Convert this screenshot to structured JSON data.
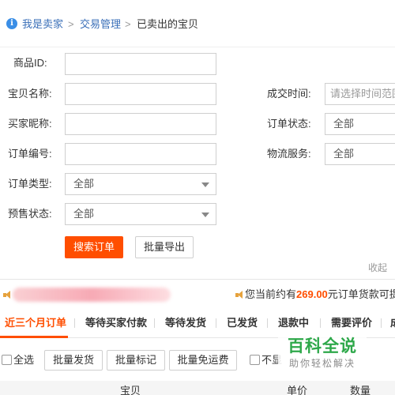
{
  "breadcrumb": {
    "items": [
      "我是卖家",
      "交易管理",
      "已卖出的宝贝"
    ],
    "separator": ">"
  },
  "form": {
    "item_id_label": "商品ID:",
    "item_name_label": "宝贝名称:",
    "buyer_nick_label": "买家昵称:",
    "order_no_label": "订单编号:",
    "order_type_label": "订单类型:",
    "order_type_value": "全部",
    "presale_label": "预售状态:",
    "presale_value": "全部",
    "deal_time_label": "成交时间:",
    "deal_time_placeholder": "请选择时间范围",
    "order_status_label": "订单状态:",
    "order_status_value": "全部",
    "logistics_label": "物流服务:",
    "logistics_value": "全部",
    "search_button": "搜索订单",
    "export_button": "批量导出",
    "collapse": "收起"
  },
  "notice": {
    "prefix": "您当前约有",
    "amount": "269.00",
    "suffix": "元订单货款可提"
  },
  "tabs": [
    "近三个月订单",
    "等待买家付款",
    "等待发货",
    "已发货",
    "退款中",
    "需要评价",
    "成"
  ],
  "bulk": {
    "select_all": "全选",
    "ship": "批量发货",
    "mark": "批量标记",
    "free_shipping": "批量免运费",
    "partial_checkbox_label": "不显"
  },
  "table_header": {
    "item": "宝贝",
    "price": "单价",
    "qty": "数量"
  },
  "watermark": {
    "title": "百科全说",
    "subtitle": "助你轻松解决"
  },
  "colors": {
    "accent": "#ff4e00",
    "link": "#3a6fb8",
    "info": "#3a8ee6",
    "watermark": "#2ea84a"
  }
}
